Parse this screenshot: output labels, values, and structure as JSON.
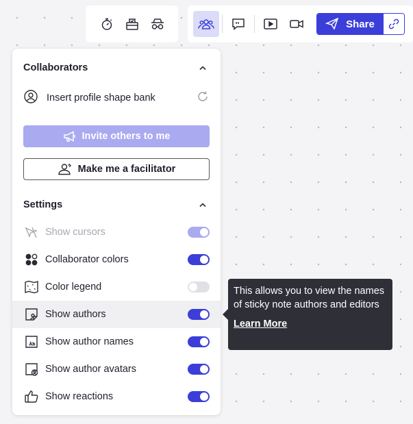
{
  "toolbar_left": {
    "icons": [
      "timer-icon",
      "voting-icon",
      "private-mode-icon"
    ]
  },
  "toolbar_right": {
    "icons": [
      "collaborators-icon",
      "comment-icon",
      "presentation-icon",
      "video-icon"
    ],
    "share_label": "Share",
    "share_link_icon": "link-icon"
  },
  "colors": {
    "accent": "#3b3ed9",
    "accent_light": "#a9aaf0",
    "tooltip_bg": "#2e2f37"
  },
  "collaborators": {
    "title": "Collaborators",
    "profile_label": "Insert profile shape bank",
    "invite_label": "Invite others to me",
    "facilitator_label": "Make me a facilitator"
  },
  "settings": {
    "title": "Settings",
    "items": [
      {
        "label": "Show cursors",
        "icon": "cursors-off-icon",
        "state": "on",
        "disabled": true
      },
      {
        "label": "Collaborator colors",
        "icon": "color-dots-icon",
        "state": "on",
        "disabled": false
      },
      {
        "label": "Color legend",
        "icon": "map-legend-icon",
        "state": "off",
        "disabled": false
      },
      {
        "label": "Show authors",
        "icon": "sticky-author-icon",
        "state": "on",
        "disabled": false
      },
      {
        "label": "Show author names",
        "icon": "sticky-name-icon",
        "state": "on",
        "disabled": false
      },
      {
        "label": "Show author avatars",
        "icon": "sticky-avatar-icon",
        "state": "on",
        "disabled": false
      },
      {
        "label": "Show reactions",
        "icon": "thumbs-up-icon",
        "state": "on",
        "disabled": false
      }
    ]
  },
  "tooltip": {
    "text": "This allows you to view the names of sticky note authors and editors",
    "link": "Learn More"
  }
}
